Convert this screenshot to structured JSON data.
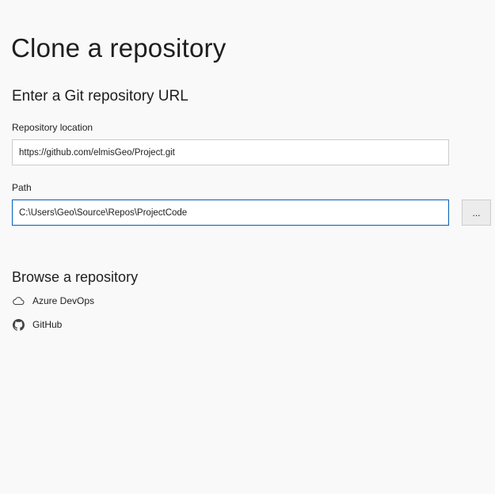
{
  "page": {
    "title": "Clone a repository",
    "subtitle": "Enter a Git repository URL"
  },
  "repository_location": {
    "label": "Repository location",
    "value": "https://github.com/elmisGeo/Project.git"
  },
  "path": {
    "label": "Path",
    "value": "C:\\Users\\Geo\\Source\\Repos\\ProjectCode",
    "browse_label": "..."
  },
  "browse": {
    "title": "Browse a repository",
    "providers": [
      {
        "label": "Azure DevOps",
        "icon": "cloud-icon"
      },
      {
        "label": "GitHub",
        "icon": "github-icon"
      }
    ]
  },
  "colors": {
    "background": "#f9f9f9",
    "focus_border": "#005fb8"
  }
}
